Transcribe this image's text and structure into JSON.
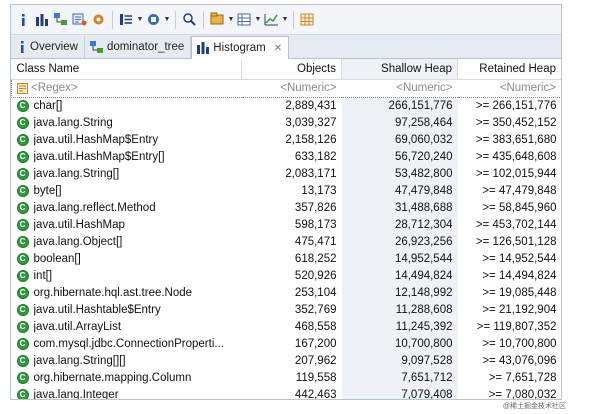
{
  "toolbar": {
    "icons": [
      "info-icon",
      "histogram-icon",
      "dominator-tree-icon",
      "query-browser-icon",
      "settings-icon",
      "overview-dropdown-icon",
      "group-by-dropdown-icon",
      "search-icon",
      "calculator-dropdown-icon",
      "export-dropdown-icon",
      "chart-dropdown-icon",
      "grid-icon"
    ]
  },
  "tabs": [
    {
      "label": "Overview",
      "icon": "info-icon",
      "active": false
    },
    {
      "label": "dominator_tree",
      "icon": "dominator-tree-icon",
      "active": false
    },
    {
      "label": "Histogram",
      "icon": "histogram-icon",
      "active": true,
      "closable": true
    }
  ],
  "table": {
    "headers": {
      "class_name": "Class Name",
      "objects": "Objects",
      "shallow_heap": "Shallow Heap",
      "retained_heap": "Retained Heap"
    },
    "filter": {
      "class_name": "<Regex>",
      "objects": "<Numeric>",
      "shallow_heap": "<Numeric>",
      "retained_heap": "<Numeric>"
    },
    "rows": [
      {
        "class_name": "char[]",
        "objects": "2,889,431",
        "shallow_heap": "266,151,776",
        "retained_heap": ">= 266,151,776"
      },
      {
        "class_name": "java.lang.String",
        "objects": "3,039,327",
        "shallow_heap": "97,258,464",
        "retained_heap": ">= 350,452,152"
      },
      {
        "class_name": "java.util.HashMap$Entry",
        "objects": "2,158,126",
        "shallow_heap": "69,060,032",
        "retained_heap": ">= 383,651,680"
      },
      {
        "class_name": "java.util.HashMap$Entry[]",
        "objects": "633,182",
        "shallow_heap": "56,720,240",
        "retained_heap": ">= 435,648,608"
      },
      {
        "class_name": "java.lang.String[]",
        "objects": "2,083,171",
        "shallow_heap": "53,482,800",
        "retained_heap": ">= 102,015,944"
      },
      {
        "class_name": "byte[]",
        "objects": "13,173",
        "shallow_heap": "47,479,848",
        "retained_heap": ">= 47,479,848"
      },
      {
        "class_name": "java.lang.reflect.Method",
        "objects": "357,826",
        "shallow_heap": "31,488,688",
        "retained_heap": ">= 58,845,960"
      },
      {
        "class_name": "java.util.HashMap",
        "objects": "598,173",
        "shallow_heap": "28,712,304",
        "retained_heap": ">= 453,702,144"
      },
      {
        "class_name": "java.lang.Object[]",
        "objects": "475,471",
        "shallow_heap": "26,923,256",
        "retained_heap": ">= 126,501,128"
      },
      {
        "class_name": "boolean[]",
        "objects": "618,252",
        "shallow_heap": "14,952,544",
        "retained_heap": ">= 14,952,544"
      },
      {
        "class_name": "int[]",
        "objects": "520,926",
        "shallow_heap": "14,494,824",
        "retained_heap": ">= 14,494,824"
      },
      {
        "class_name": "org.hibernate.hql.ast.tree.Node",
        "objects": "253,104",
        "shallow_heap": "12,148,992",
        "retained_heap": ">= 19,085,448"
      },
      {
        "class_name": "java.util.Hashtable$Entry",
        "objects": "352,769",
        "shallow_heap": "11,288,608",
        "retained_heap": ">= 21,192,904"
      },
      {
        "class_name": "java.util.ArrayList",
        "objects": "468,558",
        "shallow_heap": "11,245,392",
        "retained_heap": ">= 119,807,352"
      },
      {
        "class_name": "com.mysql.jdbc.ConnectionProperti...",
        "objects": "167,200",
        "shallow_heap": "10,700,800",
        "retained_heap": ">= 10,700,800"
      },
      {
        "class_name": "java.lang.String[][]",
        "objects": "207,962",
        "shallow_heap": "9,097,528",
        "retained_heap": ">= 43,076,096"
      },
      {
        "class_name": "org.hibernate.mapping.Column",
        "objects": "119,558",
        "shallow_heap": "7,651,712",
        "retained_heap": ">= 7,651,728"
      },
      {
        "class_name": "java.lang.Integer",
        "objects": "442,463",
        "shallow_heap": "7,079,408",
        "retained_heap": ">= 7,080,032"
      }
    ]
  },
  "watermark": "@稀土掘金技术社区",
  "colors": {
    "class_icon": "#2f9a3d",
    "sorted_column": "#eef1f5",
    "toolbar_bg": "#f3f5f9",
    "tab_bar_bg": "#e6ebf2"
  }
}
